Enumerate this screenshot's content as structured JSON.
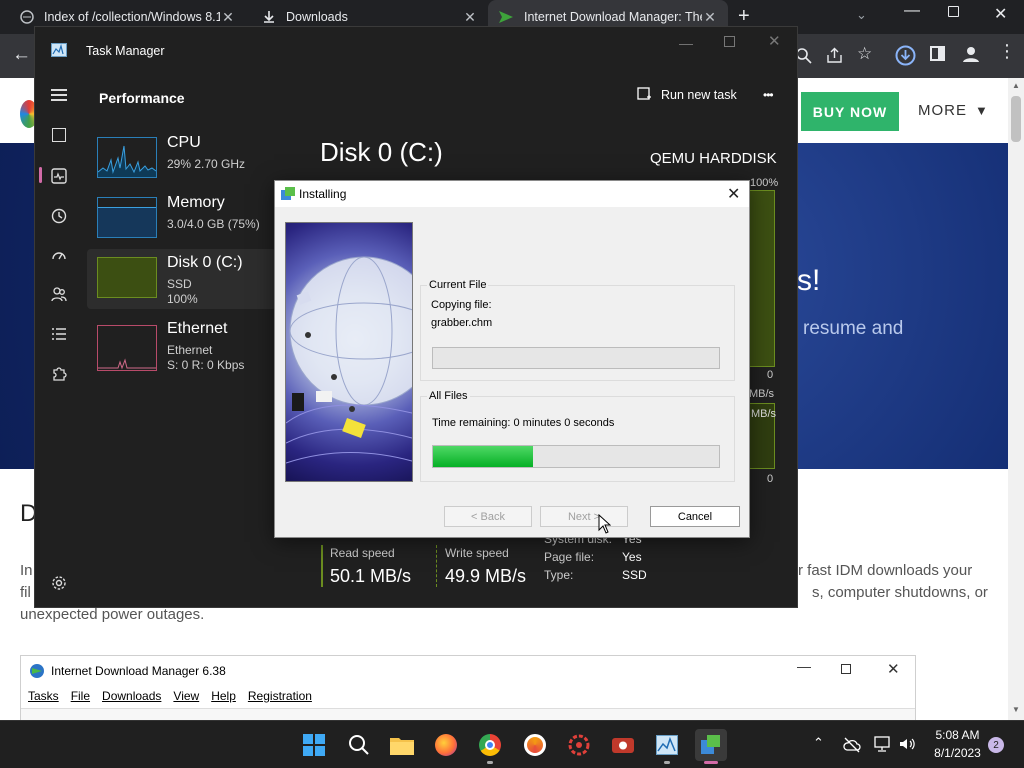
{
  "browser": {
    "tabs": [
      {
        "title": "Index of /collection/Windows 8.1",
        "icon": "folder-icon"
      },
      {
        "title": "Downloads",
        "icon": "download-icon"
      },
      {
        "title": "Internet Download Manager: The",
        "icon": "idm-arrow-icon"
      }
    ],
    "new_tab_label": "+",
    "page": {
      "buy_now": "BUY NOW",
      "more": "MORE",
      "hero_fragment_1": "s!",
      "hero_fragment_2": "resume and",
      "left_letter": "D",
      "body_left_1": "In",
      "body_left_2": "fil",
      "body_right_1": "r fast IDM downloads your",
      "body_right_2": "s, computer shutdowns, or",
      "body_line_3": "unexpected power outages."
    }
  },
  "task_manager": {
    "title": "Task Manager",
    "section": "Performance",
    "run_new_task": "Run new task",
    "more_label": "•••",
    "items": [
      {
        "name": "CPU",
        "sub1": "29%  2.70 GHz",
        "sub2": ""
      },
      {
        "name": "Memory",
        "sub1": "3.0/4.0 GB (75%)",
        "sub2": ""
      },
      {
        "name": "Disk 0 (C:)",
        "sub1": "SSD",
        "sub2": "100%"
      },
      {
        "name": "Ethernet",
        "sub1": "Ethernet",
        "sub2": "S: 0  R: 0 Kbps"
      }
    ],
    "detail": {
      "title": "Disk 0 (C:)",
      "model": "QEMU HARDDISK",
      "graph_max": "100%",
      "graph_zero_1": "0",
      "graph_unit": "MB/s",
      "graph_unit_2": "MB/s",
      "graph_zero_2": "0",
      "read_speed_label": "Read speed",
      "read_speed": "50.1 MB/s",
      "write_speed_label": "Write speed",
      "write_speed": "49.9 MB/s",
      "props": [
        {
          "k": "System disk:",
          "v": "Yes"
        },
        {
          "k": "Page file:",
          "v": "Yes"
        },
        {
          "k": "Type:",
          "v": "SSD"
        }
      ]
    }
  },
  "installer": {
    "title": "Installing",
    "current_file_label": "Current File",
    "copying_label": "Copying file:",
    "file_name": "grabber.chm",
    "current_progress": 0,
    "all_files_label": "All Files",
    "time_remaining": "Time remaining: 0 minutes 0 seconds",
    "all_progress": 0.35,
    "back": "< Back",
    "next": "Next >",
    "cancel": "Cancel"
  },
  "idm": {
    "title": "Internet Download Manager 6.38",
    "menu": [
      "Tasks",
      "File",
      "Downloads",
      "View",
      "Help",
      "Registration"
    ]
  },
  "taskbar": {
    "time": "5:08 AM",
    "date": "8/1/2023",
    "notification_count": "2"
  },
  "colors": {
    "accent_green": "#2fb46b",
    "progress_green": "#06b025",
    "tm_selected": "#2d2d2d"
  }
}
